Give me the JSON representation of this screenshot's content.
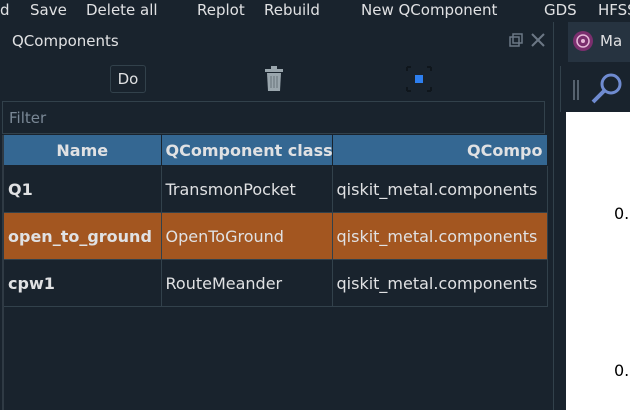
{
  "toolbar": {
    "items": [
      "d",
      "Save",
      "Delete all",
      "Replot",
      "Rebuild",
      "New QComponent",
      "GDS",
      "HFSS"
    ]
  },
  "dock": {
    "title": "QComponents",
    "action_do_label": "Do",
    "filter_placeholder": "Filter"
  },
  "table": {
    "columns": [
      "Name",
      "QComponent class",
      "QCompo"
    ],
    "rows": [
      {
        "name": "Q1",
        "class": "TransmonPocket",
        "module": "qiskit_metal.components"
      },
      {
        "name": "open_to_ground",
        "class": "OpenToGround",
        "module": "qiskit_metal.components"
      },
      {
        "name": "cpw1",
        "class": "RouteMeander",
        "module": "qiskit_metal.components"
      }
    ],
    "selected_row": 1
  },
  "right": {
    "tab_label": "Ma",
    "axis_labels": [
      "0.",
      "0."
    ]
  },
  "colors": {
    "background": "#19232d",
    "header": "#346792",
    "selection": "#a35620"
  }
}
